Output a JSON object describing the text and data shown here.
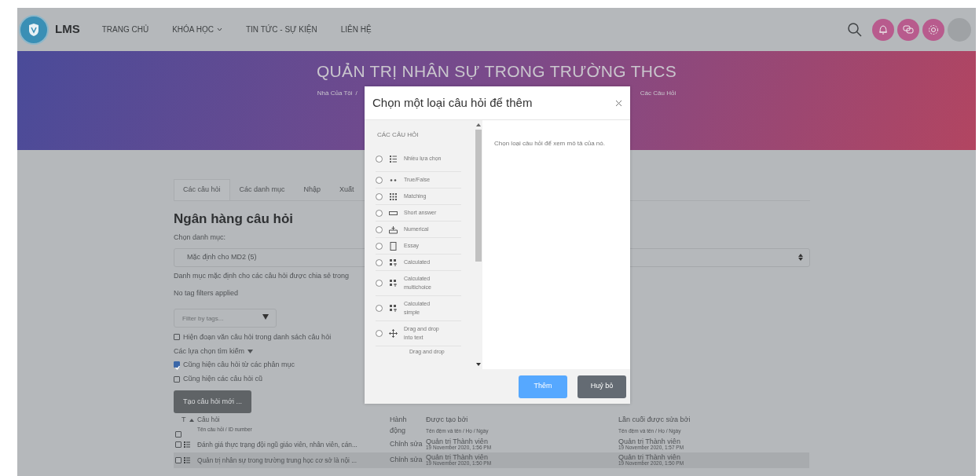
{
  "navbar": {
    "brand": "LMS",
    "links": [
      {
        "label": "TRANG CHỦ",
        "dropdown": false
      },
      {
        "label": "KHÓA HỌC",
        "dropdown": true
      },
      {
        "label": "TIN TỨC - SỰ KIỆN",
        "dropdown": false
      },
      {
        "label": "LIÊN HỆ",
        "dropdown": false
      }
    ]
  },
  "banner": {
    "title": "QUẢN TRỊ NHÂN SỰ TRONG TRƯỜNG THCS",
    "breadcrumb": [
      "Nhà Của Tôi",
      "Các Câu Hỏi"
    ],
    "separator": "/"
  },
  "page": {
    "tabs": [
      {
        "label": "Các câu hỏi",
        "selected": true
      },
      {
        "label": "Các danh mục",
        "selected": false
      },
      {
        "label": "Nhập",
        "selected": false
      },
      {
        "label": "Xuất",
        "selected": false
      }
    ],
    "heading": "Ngân hàng câu hỏi",
    "category_label": "Chọn danh mục:",
    "category_select": "Mặc định cho MD2 (5)",
    "category_note": "Danh mục mặc định cho các câu hỏi được chia sẻ trong",
    "tag_note": "No tag filters applied",
    "tag_filter": {
      "placeholder": "Filter by tags..."
    },
    "show_text_option": {
      "label": "Hiện đoạn văn câu hỏi trong danh sách câu hỏi",
      "checked": false
    },
    "search_options_label": "Các lựa chọn tìm kiếm",
    "search_options": [
      {
        "label": "Cũng hiện câu hỏi từ các phân mục",
        "checked": true
      },
      {
        "label": "Cũng hiện các câu hỏi cũ",
        "checked": false
      }
    ],
    "create_button": "Tạo câu hỏi mới ..."
  },
  "table": {
    "type_header": "T",
    "select_all": {
      "checked": false
    },
    "columns": [
      {
        "title": "Câu hỏi",
        "subtitle": "Tên câu hỏi / ID number"
      },
      {
        "title": "Hành động"
      },
      {
        "title": "Được tạo bởi",
        "subtitle": "Tên đệm và tên / Họ / Ngày"
      },
      {
        "title": "Lần cuối được sửa bởi",
        "subtitle": "Tên đệm và tên / Họ / Ngày"
      }
    ],
    "rows": [
      {
        "checked": false,
        "question": "Đánh giá thực trạng đội ngũ giáo viên, nhân viên, cán...",
        "action": "Chỉnh sửa",
        "created_by": "Quản trị Thành viên",
        "created_date": "19 November 2020, 1:56 PM",
        "modified_by": "Quản trị Thành viên",
        "modified_date": "19 November 2020, 1:57 PM"
      },
      {
        "checked": false,
        "question": "Quản trị nhân sự trong trường trung học cơ sở là nội ...",
        "action": "Chỉnh sửa",
        "created_by": "Quản trị Thành viên",
        "created_date": "19 November 2020, 1:50 PM",
        "modified_by": "Quản trị Thành viên",
        "modified_date": "19 November 2020, 1:50 PM"
      }
    ]
  },
  "modal": {
    "title": "Chọn một loại câu hỏi để thêm",
    "section_label": "CÁC CÂU HỎI",
    "description": "Chọn loại câu hỏi để xem mô tả của nó.",
    "types": [
      {
        "label": "Nhiều lựa chọn",
        "kind": "list",
        "selected": false
      },
      {
        "label": "True/False",
        "kind": "dots",
        "selected": false
      },
      {
        "label": "Matching",
        "kind": "grid",
        "selected": false
      },
      {
        "label": "Short answer",
        "kind": "box",
        "selected": false
      },
      {
        "label": "Numerical",
        "kind": "tray",
        "selected": false
      },
      {
        "label": "Essay",
        "kind": "page",
        "selected": false
      },
      {
        "label": "Calculated",
        "kind": "calc",
        "selected": false
      },
      {
        "label": "Calculated multichoice",
        "kind": "calc",
        "selected": false
      },
      {
        "label": "Calculated simple",
        "kind": "calc",
        "selected": false
      },
      {
        "label": "Drag and drop into text",
        "kind": "move",
        "selected": false
      },
      {
        "label": "Drag and drop"
      }
    ],
    "buttons": [
      {
        "label": "Thêm",
        "kind": "primary"
      },
      {
        "label": "Huỷ bỏ",
        "kind": "secondary"
      }
    ]
  }
}
